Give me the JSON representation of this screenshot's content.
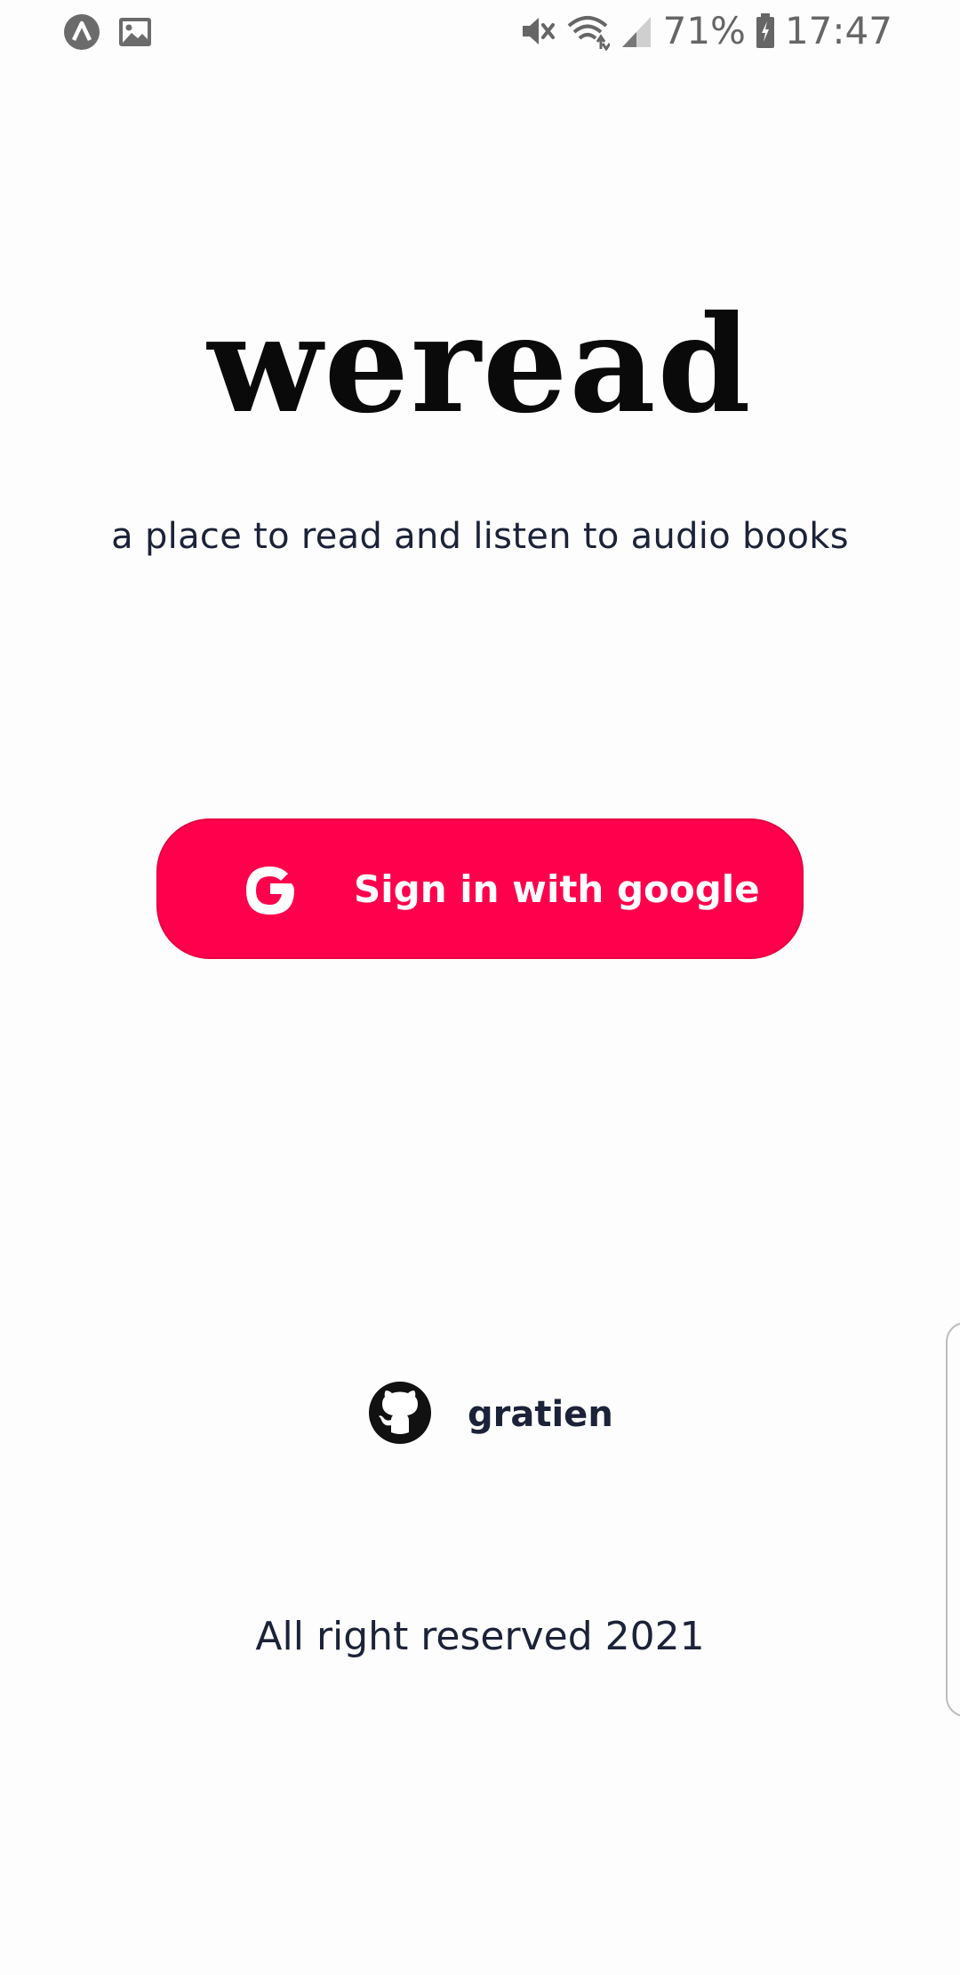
{
  "status_bar": {
    "battery": "71%",
    "time": "17:47",
    "left_icons": [
      "app-notification-icon",
      "image-notification-icon"
    ],
    "right_icons": [
      "mute-icon",
      "wifi-icon",
      "signal-icon",
      "battery-icon"
    ]
  },
  "app": {
    "logo_text": "weread",
    "tagline": "a place to read and listen to audio books"
  },
  "sign_in": {
    "label": "Sign in with google",
    "icon": "google-icon",
    "color": "#ff004d"
  },
  "github": {
    "icon": "github-icon",
    "username": "gratien"
  },
  "footer": {
    "copyright": "All right reserved 2021"
  }
}
